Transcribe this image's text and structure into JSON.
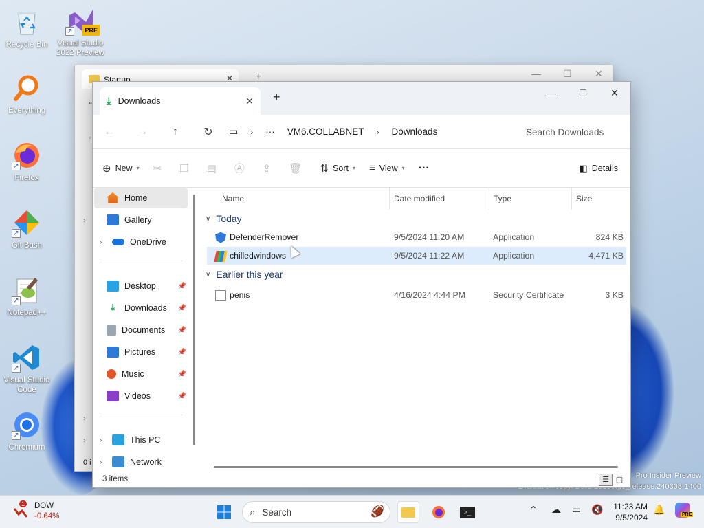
{
  "desktop": {
    "icons": [
      {
        "label": "Recycle Bin"
      },
      {
        "label": "Visual Studio 2022 Preview",
        "badge": "PRE"
      },
      {
        "label": "Everything"
      },
      {
        "label": "Firefox"
      },
      {
        "label": "Git Bash"
      },
      {
        "label": "Notepad++"
      },
      {
        "label": "Visual Studio Code"
      },
      {
        "label": "Chromium"
      }
    ],
    "watermark": [
      "Pro Insider Preview",
      "Evaluation copy. Build 26100.ge_release.240308-1400"
    ]
  },
  "back_window": {
    "tab_title": "Startup",
    "status_partial": "0 i"
  },
  "explorer": {
    "tab_title": "Downloads",
    "breadcrumb": [
      "VM6.COLLABNET",
      "Downloads"
    ],
    "search_placeholder": "Search Downloads",
    "commands": {
      "new": "New",
      "sort": "Sort",
      "view": "View",
      "more": "···",
      "details": "Details"
    },
    "nav": {
      "home": "Home",
      "gallery": "Gallery",
      "onedrive": "OneDrive",
      "quick": [
        "Desktop",
        "Downloads",
        "Documents",
        "Pictures",
        "Music",
        "Videos"
      ],
      "this_pc": "This PC",
      "network": "Network"
    },
    "columns": {
      "name": "Name",
      "date": "Date modified",
      "type": "Type",
      "size": "Size"
    },
    "groups": [
      {
        "label": "Today",
        "files": [
          {
            "name": "DefenderRemover",
            "date": "9/5/2024 11:20 AM",
            "type": "Application",
            "size": "824 KB"
          },
          {
            "name": "chilledwindows",
            "date": "9/5/2024 11:22 AM",
            "type": "Application",
            "size": "4,471 KB"
          }
        ]
      },
      {
        "label": "Earlier this year",
        "files": [
          {
            "name": "penis",
            "date": "4/16/2024 4:44 PM",
            "type": "Security Certificate",
            "size": "3 KB"
          }
        ]
      }
    ],
    "status": "3 items"
  },
  "taskbar": {
    "widget": {
      "ticker": "DOW",
      "change": "-0.64%",
      "badge": "1"
    },
    "search": "Search",
    "time": "11:23 AM",
    "date": "9/5/2024",
    "copilot_badge": "PRE"
  }
}
